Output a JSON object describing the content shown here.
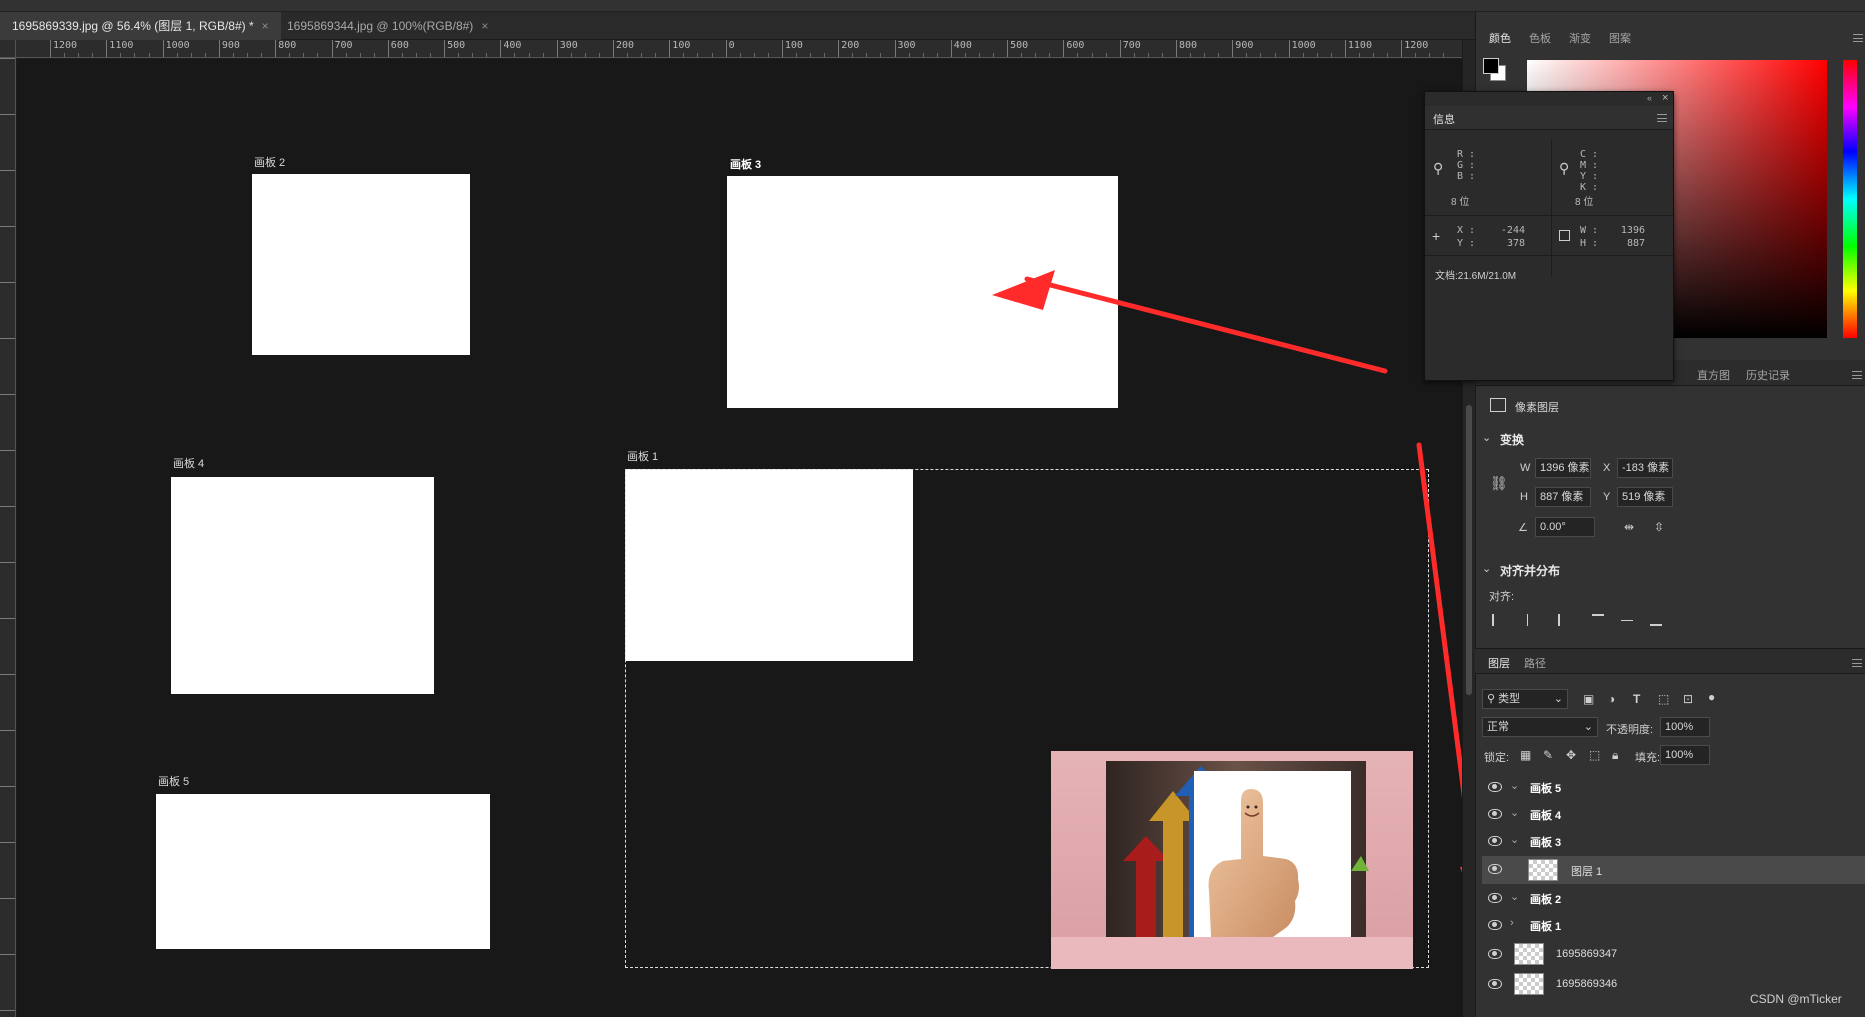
{
  "tabs": [
    {
      "label": "1695869339.jpg @ 56.4% (图层 1, RGB/8#) *",
      "close": "×"
    },
    {
      "label": "1695869344.jpg @ 100%(RGB/8#)",
      "close": "×"
    }
  ],
  "ruler_h": [
    "1200",
    "1100",
    "1000",
    "900",
    "800",
    "700",
    "600",
    "500",
    "400",
    "300",
    "200",
    "100",
    "0",
    "100",
    "200",
    "300",
    "400",
    "500",
    "600",
    "700",
    "800",
    "900",
    "1000",
    "1100",
    "1200"
  ],
  "artboards": {
    "board2": "画板 2",
    "board3": "画板 3",
    "board4": "画板 4",
    "board1": "画板 1",
    "board5": "画板 5"
  },
  "color_panel": {
    "tabs": [
      "颜色",
      "色板",
      "渐变",
      "图案"
    ]
  },
  "info_panel": {
    "title": "信息",
    "rgb_labels": [
      "R :",
      "G :",
      "B :"
    ],
    "cmyk_labels": [
      "C :",
      "M :",
      "Y :",
      "K :"
    ],
    "bits_left": "8 位",
    "bits_right": "8 位",
    "x_label": "X :",
    "x_value": "-244",
    "y_label": "Y :",
    "y_value": "378",
    "w_label": "W :",
    "w_value": "1396",
    "h_label": "H :",
    "h_value": "887",
    "doc": "文档:21.6M/21.0M"
  },
  "props_tabs": [
    "直方图",
    "历史记录"
  ],
  "properties": {
    "layer_kind": "像素图层",
    "transform_title": "变换",
    "w_label": "W",
    "w_value": "1396 像素",
    "x_label": "X",
    "x_value": "-183 像素",
    "h_label": "H",
    "h_value": "887 像素",
    "y_label": "Y",
    "y_value": "519 像素",
    "angle": "0.00°",
    "align_title": "对齐并分布",
    "align_label": "对齐:"
  },
  "layers_panel": {
    "tabs": [
      "图层",
      "路径"
    ],
    "filter": "类型",
    "blend_mode": "正常",
    "opacity_label": "不透明度:",
    "opacity_value": "100%",
    "lock_label": "锁定:",
    "fill_label": "填充:",
    "fill_value": "100%",
    "rows": [
      {
        "name": "画板 5",
        "chev": "⌄",
        "bold": true
      },
      {
        "name": "画板 4",
        "chev": "⌄",
        "bold": true
      },
      {
        "name": "画板 3",
        "chev": "⌄",
        "bold": true
      },
      {
        "name": "图层 1",
        "chev": "",
        "bold": false
      },
      {
        "name": "画板 2",
        "chev": "⌄",
        "bold": true
      },
      {
        "name": "画板 1",
        "chev": "›",
        "bold": true
      },
      {
        "name": "1695869347",
        "chev": "",
        "bold": false
      },
      {
        "name": "1695869346",
        "chev": "",
        "bold": false
      }
    ]
  },
  "watermark": "CSDN @mTicker",
  "accent": "#ff2a2a"
}
